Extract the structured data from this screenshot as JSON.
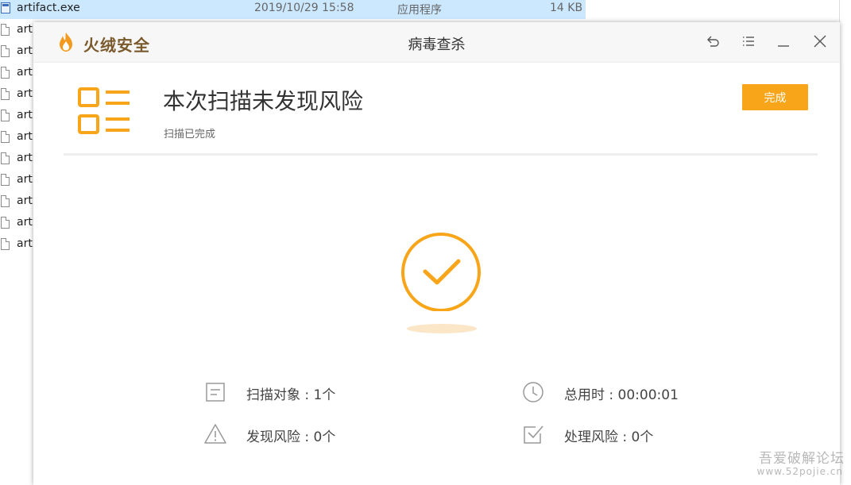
{
  "explorer": {
    "first_file": {
      "name": "artifact.exe",
      "date": "2019/10/29 15:58",
      "type": "应用程序",
      "size": "14 KB"
    },
    "other_files": [
      "art",
      "art",
      "art",
      "art",
      "art",
      "art",
      "art",
      "art",
      "art",
      "art",
      "art"
    ]
  },
  "window": {
    "brand": "火绒安全",
    "title": "病毒查杀"
  },
  "result": {
    "title": "本次扫描未发现风险",
    "subtitle": "扫描已完成",
    "done_button": "完成"
  },
  "stats": {
    "scan_objects": "扫描对象 : 1个",
    "total_time": "总用时 : 00:00:01",
    "risks_found": "发现风险 : 0个",
    "risks_handled": "处理风险 : 0个"
  },
  "colors": {
    "accent": "#f8a51a",
    "brand_text": "#7a5a2c"
  },
  "icons": [
    "back-icon",
    "menu-icon",
    "minimize-icon",
    "close-icon",
    "document-icon",
    "clock-icon",
    "warning-icon",
    "checkbox-icon",
    "checkmark-circle-icon",
    "list-icon"
  ],
  "watermark": {
    "line1": "吾爱破解论坛",
    "line2": "www.52pojie.cn"
  }
}
